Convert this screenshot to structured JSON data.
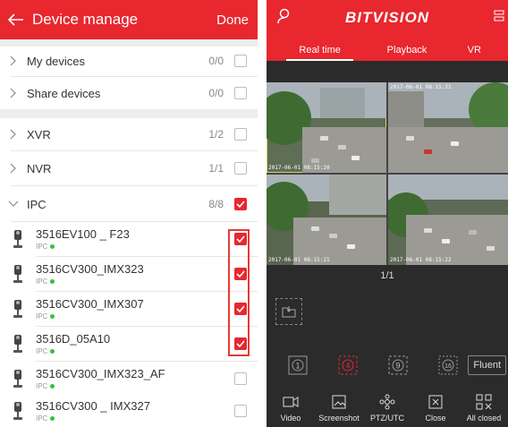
{
  "left_panel": {
    "header": {
      "title": "Device manage",
      "done_label": "Done"
    },
    "groups": [
      {
        "label": "My devices",
        "count": "0/0",
        "checked": false
      },
      {
        "label": "Share devices",
        "count": "0/0",
        "checked": false
      },
      {
        "label": "XVR",
        "count": "1/2",
        "checked": false
      },
      {
        "label": "NVR",
        "count": "1/1",
        "checked": false
      },
      {
        "label": "IPC",
        "count": "8/8",
        "checked": true
      }
    ],
    "devices": [
      {
        "name": "3516EV100 _ F23",
        "type": "IPC",
        "checked": true
      },
      {
        "name": "3516CV300_IMX323",
        "type": "IPC",
        "checked": true
      },
      {
        "name": "3516CV300_IMX307",
        "type": "IPC",
        "checked": true
      },
      {
        "name": "3516D_05A10",
        "type": "IPC",
        "checked": true
      },
      {
        "name": "3516CV300_IMX323_AF",
        "type": "IPC",
        "checked": false
      },
      {
        "name": "3516CV300 _ IMX327",
        "type": "IPC",
        "checked": false
      }
    ]
  },
  "right_panel": {
    "brand": "BITVISION",
    "tabs": [
      "Real time",
      "Playback",
      "VR"
    ],
    "active_tab": "Real time",
    "page_indicator": "1/1",
    "split_buttons": [
      "1",
      "4",
      "9",
      "16"
    ],
    "active_split": "4",
    "stream_quality": "Fluent",
    "toolbar": [
      "Video",
      "Screenshot",
      "PTZ/UTC",
      "Close",
      "All closed"
    ],
    "camera_overlays": [
      "2017-06-01 08:15:20",
      "2017-06-01 08:15:21",
      "2017-06-01 08:15:21",
      "2017-06-01 08:15:22"
    ],
    "colors": {
      "accent": "#e8272f",
      "online": "#35c13a",
      "dark_bg": "#2b2b2b"
    }
  }
}
